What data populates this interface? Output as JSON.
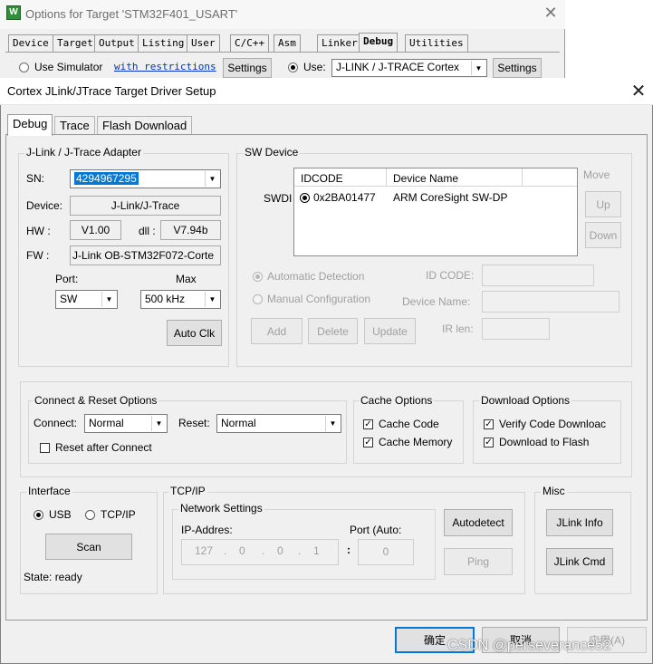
{
  "bg_window": {
    "title": "Options for Target 'STM32F401_USART'",
    "app_icon": "W",
    "close": "✕",
    "tabs": [
      "Device",
      "Target",
      "Output",
      "Listing",
      "User",
      "C/C++",
      "Asm",
      "Linker",
      "Debug",
      "Utilities"
    ],
    "active_tab": "Debug",
    "use_simulator": "Use Simulator",
    "with_restrictions": "with restrictions",
    "settings_left": "Settings",
    "use_label": "Use:",
    "use_value": "J-LINK / J-TRACE Cortex",
    "settings_right": "Settings"
  },
  "dialog": {
    "title": "Cortex JLink/JTrace Target Driver Setup",
    "close": "✕",
    "tabs": [
      "Debug",
      "Trace",
      "Flash Download"
    ],
    "active_tab": "Debug"
  },
  "adapter": {
    "title": "J-Link / J-Trace Adapter",
    "sn_label": "SN:",
    "sn_value": "4294967295",
    "device_label": "Device:",
    "device_value": "J-Link/J-Trace",
    "hw_label": "HW :",
    "hw_value": "V1.00",
    "dll_label": "dll :",
    "dll_value": "V7.94b",
    "fw_label": "FW :",
    "fw_value": "J-Link OB-STM32F072-Corte",
    "port_label": "Port:",
    "port_value": "SW",
    "max_label": "Max",
    "max_value": "500 kHz",
    "auto_clk": "Auto Clk"
  },
  "sw_device": {
    "title": "SW Device",
    "swdi_label": "SWDI",
    "columns": [
      "IDCODE",
      "Device Name"
    ],
    "rows": [
      {
        "idcode": "0x2BA01477",
        "name": "ARM CoreSight SW-DP"
      }
    ],
    "move_label": "Move",
    "up": "Up",
    "down": "Down",
    "automatic_detection": "Automatic Detection",
    "manual_configuration": "Manual Configuration",
    "id_code_label": "ID CODE:",
    "device_name_label": "Device Name:",
    "ir_len_label": "IR len:",
    "add": "Add",
    "delete": "Delete",
    "update": "Update"
  },
  "connect_reset": {
    "title": "Connect & Reset Options",
    "connect_label": "Connect:",
    "connect_value": "Normal",
    "reset_label": "Reset:",
    "reset_value": "Normal",
    "reset_after_connect": "Reset after Connect"
  },
  "cache": {
    "title": "Cache Options",
    "cache_code": "Cache Code",
    "cache_memory": "Cache Memory"
  },
  "download": {
    "title": "Download Options",
    "verify": "Verify Code Downloac",
    "download_to_flash": "Download to Flash"
  },
  "interface": {
    "title": "Interface",
    "usb": "USB",
    "tcpip": "TCP/IP",
    "scan": "Scan",
    "state": "State: ready"
  },
  "tcpip": {
    "title": "TCP/IP",
    "network_settings": "Network Settings",
    "ip_label": "IP-Addres:",
    "ip": [
      "127",
      "0",
      "0",
      "1"
    ],
    "port_label": "Port (Auto:",
    "port_value": "0",
    "autodetect": "Autodetect",
    "ping": "Ping"
  },
  "misc": {
    "title": "Misc",
    "jlink_info": "JLink Info",
    "jlink_cmd": "JLink Cmd"
  },
  "footer": {
    "ok": "确定",
    "cancel": "取消",
    "apply": "应用(A)"
  },
  "watermark": "CSDN @perseverance52",
  "colors": {
    "selection": "#0078d7",
    "dialog_bg": "#f0f0f0",
    "disabled_text": "#a0a0a0"
  }
}
